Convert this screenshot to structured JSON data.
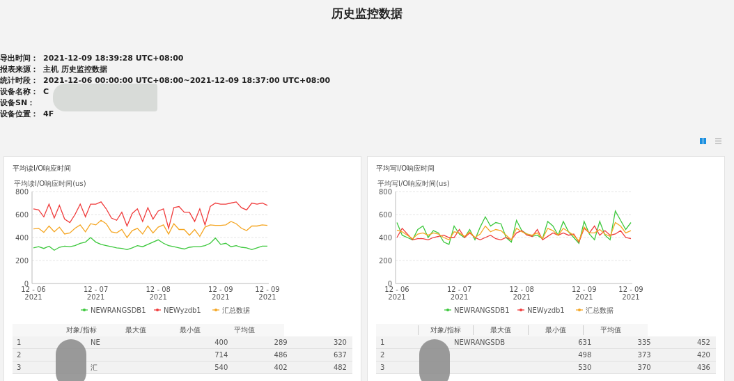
{
  "title": "历史监控数据",
  "info": [
    {
      "label": "导出时间：",
      "value": "2021-12-09 18:39:28 UTC+08:00"
    },
    {
      "label": "报表来源：",
      "value": "主机 历史监控数据"
    },
    {
      "label": "统计时段：",
      "value": "2021-12-06 00:00:00 UTC+08:00~2021-12-09 18:37:00 UTC+08:00"
    },
    {
      "label": "设备名称：",
      "value": "C",
      "redacted": true
    },
    {
      "label": "设备SN："
    },
    {
      "label": "设备位置：",
      "value": "4F"
    }
  ],
  "views": [
    {
      "kind": "chart",
      "selected": true
    },
    {
      "kind": "list",
      "selected": false
    }
  ],
  "panels": [
    {
      "title": "平均读I/O响应时间",
      "chart_data": {
        "type": "line",
        "grid": true,
        "legend": "bottom",
        "ylabel": "平均读I/O响应时间(us)",
        "categories": [
          "12 - 06\n2021",
          null,
          null,
          null,
          null,
          null,
          null,
          null,
          null,
          null,
          null,
          null,
          "12 - 07\n2021",
          null,
          null,
          null,
          null,
          null,
          null,
          null,
          null,
          null,
          null,
          null,
          "12 - 08\n2021",
          null,
          null,
          null,
          null,
          null,
          null,
          null,
          null,
          null,
          null,
          null,
          "12 - 09\n2021",
          null,
          null,
          null,
          null,
          null,
          null,
          null,
          null,
          "12 - 09\n2021"
        ],
        "ylim": [
          0,
          800
        ],
        "yticks": [
          0,
          200,
          400,
          600,
          800
        ],
        "series": [
          {
            "name": "NEWRANGSDB1",
            "color": "#3cc83c",
            "values": [
              310,
              320,
              305,
              325,
              290,
              315,
              325,
              320,
              330,
              350,
              360,
              400,
              360,
              340,
              330,
              320,
              310,
              305,
              295,
              310,
              330,
              320,
              340,
              360,
              380,
              350,
              330,
              320,
              310,
              300,
              315,
              320,
              320,
              330,
              350,
              395,
              340,
              350,
              320,
              330,
              315,
              310,
              295,
              310,
              325,
              325
            ]
          },
          {
            "name": "NEWyzdb1",
            "color": "#f03c3c",
            "values": [
              650,
              640,
              580,
              690,
              570,
              680,
              560,
              530,
              600,
              690,
              580,
              690,
              690,
              710,
              650,
              570,
              550,
              620,
              500,
              610,
              650,
              540,
              660,
              560,
              630,
              650,
              480,
              660,
              670,
              620,
              620,
              540,
              650,
              510,
              670,
              700,
              690,
              690,
              700,
              710,
              660,
              640,
              700,
              690,
              700,
              680
            ]
          },
          {
            "name": "汇总数据",
            "color": "#f5a623",
            "values": [
              475,
              480,
              445,
              500,
              450,
              490,
              430,
              440,
              480,
              510,
              450,
              520,
              510,
              550,
              520,
              450,
              440,
              470,
              400,
              460,
              480,
              430,
              500,
              440,
              490,
              510,
              430,
              520,
              470,
              470,
              420,
              470,
              410,
              490,
              510,
              505,
              505,
              510,
              540,
              520,
              480,
              460,
              500,
              500,
              510,
              505
            ]
          }
        ]
      },
      "table": {
        "columns": [
          "对象/指标",
          "最大值",
          "最小值",
          "平均值"
        ],
        "header_dividers": false,
        "rows": [
          {
            "index": "1",
            "name": "NE",
            "max": "400",
            "min": "289",
            "avg": "320"
          },
          {
            "index": "2",
            "max": "714",
            "min": "486",
            "avg": "637"
          },
          {
            "index": "3",
            "name": "汇",
            "max": "540",
            "min": "402",
            "avg": "482"
          }
        ]
      }
    },
    {
      "title": "平均写I/O响应时间",
      "chart_data": {
        "type": "line",
        "grid": true,
        "legend": "bottom",
        "ylabel": "平均写I/O响应时间(us)",
        "categories": [
          "12 - 06\n2021",
          null,
          null,
          null,
          null,
          null,
          null,
          null,
          null,
          null,
          null,
          null,
          "12 - 07\n2021",
          null,
          null,
          null,
          null,
          null,
          null,
          null,
          null,
          null,
          null,
          null,
          "12 - 08\n2021",
          null,
          null,
          null,
          null,
          null,
          null,
          null,
          null,
          null,
          null,
          null,
          "12 - 09\n2021",
          null,
          null,
          null,
          null,
          null,
          null,
          null,
          null,
          "12 - 09\n2021"
        ],
        "ylim": [
          0,
          800
        ],
        "yticks": [
          0,
          200,
          400,
          600,
          800
        ],
        "series": [
          {
            "name": "NEWRANGSDB1",
            "color": "#3cc83c",
            "values": [
              530,
              420,
              400,
              380,
              470,
              500,
              400,
              460,
              440,
              360,
              340,
              500,
              430,
              400,
              470,
              380,
              490,
              580,
              500,
              530,
              520,
              400,
              360,
              550,
              460,
              430,
              410,
              420,
              390,
              540,
              500,
              420,
              540,
              450,
              400,
              350,
              540,
              430,
              380,
              540,
              420,
              380,
              630,
              550,
              470,
              530
            ]
          },
          {
            "name": "NEWyzdb1",
            "color": "#f03c3c",
            "values": [
              400,
              480,
              430,
              380,
              390,
              390,
              380,
              400,
              410,
              420,
              400,
              400,
              470,
              400,
              440,
              400,
              380,
              400,
              420,
              390,
              380,
              400,
              380,
              440,
              460,
              420,
              410,
              470,
              380,
              410,
              440,
              420,
              440,
              420,
              430,
              360,
              480,
              440,
              500,
              420,
              460,
              420,
              430,
              460,
              400,
              390
            ]
          },
          {
            "name": "汇总数据",
            "color": "#f5a623",
            "values": [
              465,
              450,
              420,
              390,
              430,
              440,
              420,
              440,
              430,
              400,
              380,
              450,
              440,
              410,
              450,
              400,
              430,
              500,
              450,
              470,
              460,
              420,
              380,
              480,
              450,
              430,
              420,
              440,
              390,
              480,
              460,
              420,
              480,
              450,
              420,
              370,
              490,
              440,
              440,
              470,
              430,
              410,
              530,
              500,
              440,
              460
            ]
          }
        ]
      },
      "table": {
        "columns": [
          "对象/指标",
          "最大值",
          "最小值",
          "平均值"
        ],
        "header_dividers": true,
        "rows": [
          {
            "index": "1",
            "name": "NEWRANGSDB",
            "max": "631",
            "min": "335",
            "avg": "452"
          },
          {
            "index": "2",
            "max": "498",
            "min": "373",
            "avg": "420"
          },
          {
            "index": "3",
            "max": "530",
            "min": "370",
            "avg": "436"
          }
        ]
      }
    }
  ]
}
